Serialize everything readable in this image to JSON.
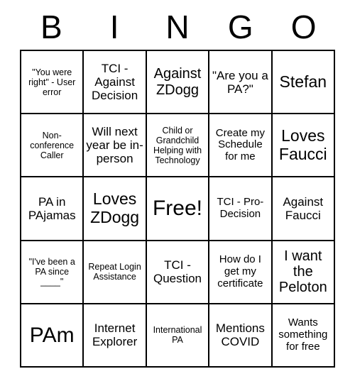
{
  "card": {
    "title": "BINGO",
    "header_letters": [
      "B",
      "I",
      "N",
      "G",
      "O"
    ],
    "free_space_label": "Free!",
    "colors": {
      "background": "#ffffff",
      "border": "#000000",
      "text": "#000000"
    },
    "grid": {
      "columns": 5,
      "rows": 5
    },
    "cells": [
      [
        {
          "text": "\"You were right\" - User error",
          "size": "xs"
        },
        {
          "text": "TCI - Against Decision",
          "size": "md"
        },
        {
          "text": "Against ZDogg",
          "size": "lg"
        },
        {
          "text": "\"Are you a PA?\"",
          "size": "md"
        },
        {
          "text": "Stefan",
          "size": "xl"
        }
      ],
      [
        {
          "text": "Non-conference Caller",
          "size": "xs"
        },
        {
          "text": "Will next year be in-person",
          "size": "md"
        },
        {
          "text": "Child or Grandchild Helping with Technology",
          "size": "xs"
        },
        {
          "text": "Create my Schedule for me",
          "size": "sm"
        },
        {
          "text": "Loves Faucci",
          "size": "xl"
        }
      ],
      [
        {
          "text": "PA in PAjamas",
          "size": "md"
        },
        {
          "text": "Loves ZDogg",
          "size": "xl"
        },
        {
          "text": "Free!",
          "size": "xxl"
        },
        {
          "text": "TCI - Pro-Decision",
          "size": "sm"
        },
        {
          "text": "Against Faucci",
          "size": "md"
        }
      ],
      [
        {
          "text": "\"I've been a PA since ____\"",
          "size": "xs"
        },
        {
          "text": "Repeat Login Assistance",
          "size": "xs"
        },
        {
          "text": "TCI - Question",
          "size": "md"
        },
        {
          "text": "How do I get my certificate",
          "size": "sm"
        },
        {
          "text": "I want the Peloton",
          "size": "lg"
        }
      ],
      [
        {
          "text": "PAm",
          "size": "xxl"
        },
        {
          "text": "Internet Explorer",
          "size": "md"
        },
        {
          "text": "International PA",
          "size": "xs"
        },
        {
          "text": "Mentions COVID",
          "size": "md"
        },
        {
          "text": "Wants something for free",
          "size": "sm"
        }
      ]
    ]
  }
}
